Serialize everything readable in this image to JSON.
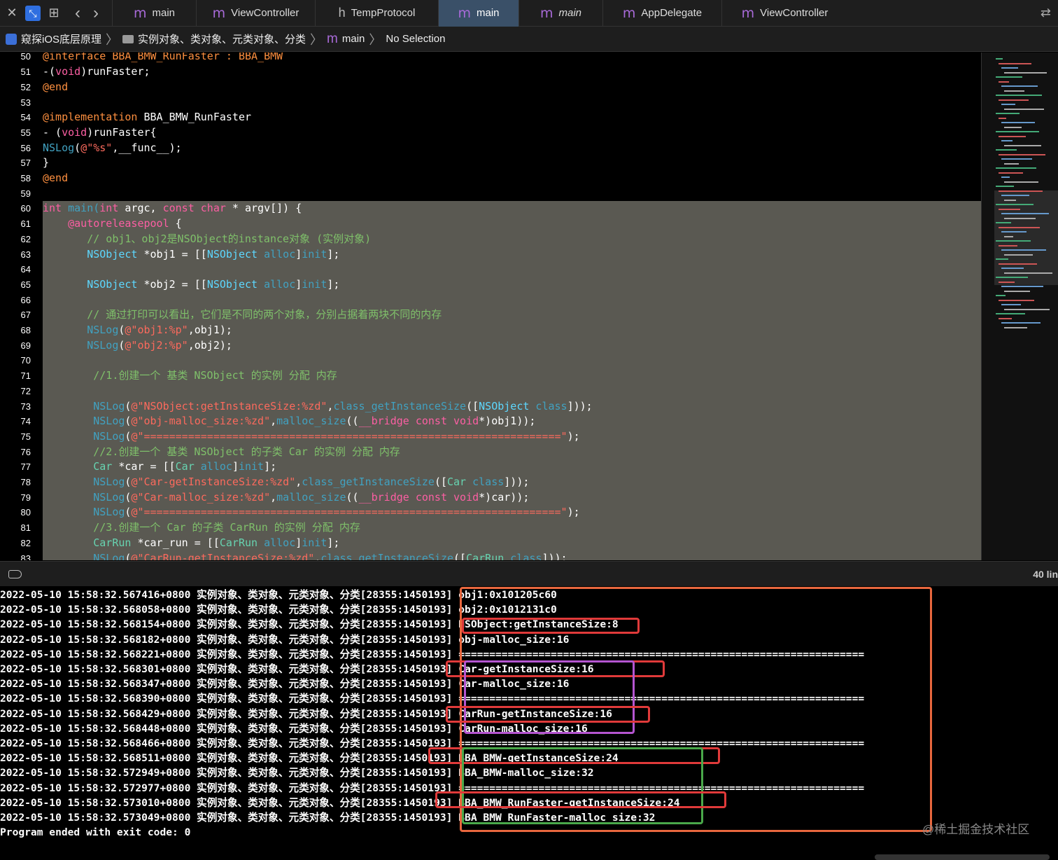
{
  "toolbar": {
    "close": "✕",
    "back": "‹",
    "forward": "›",
    "swap": "⇄"
  },
  "tabs": [
    {
      "label": "main",
      "icon": "m",
      "width": 120,
      "active": false,
      "italic": false
    },
    {
      "label": "ViewController",
      "icon": "m",
      "width": 170,
      "active": false,
      "italic": false
    },
    {
      "label": "TempProtocol",
      "icon": "h",
      "width": 176,
      "active": false,
      "italic": false
    },
    {
      "label": "main",
      "icon": "m",
      "width": 115,
      "active": true,
      "italic": false
    },
    {
      "label": "main",
      "icon": "m",
      "width": 120,
      "active": false,
      "italic": true
    },
    {
      "label": "AppDelegate",
      "icon": "m",
      "width": 170,
      "active": false,
      "italic": false
    },
    {
      "label": "ViewController",
      "icon": "m",
      "width": 180,
      "active": false,
      "italic": false
    }
  ],
  "breadcrumb": {
    "project": "窥探iOS底层原理",
    "folder": "实例对象、类对象、元类对象、分类",
    "file": "main",
    "selection": "No Selection",
    "file_icon": "m"
  },
  "editor": {
    "first_line_offset": -0.6,
    "highlight_from": 60,
    "lines": [
      {
        "n": 50,
        "t": [
          [
            "@interface BBA_BMW_RunFaster : BBA_BMW",
            "pp"
          ]
        ]
      },
      {
        "n": 51,
        "t": [
          [
            "-(",
            "pl"
          ],
          [
            "void",
            "kw"
          ],
          [
            ")runFaster;",
            "pl"
          ]
        ]
      },
      {
        "n": 52,
        "t": [
          [
            "@end",
            "pp"
          ]
        ]
      },
      {
        "n": 53,
        "t": []
      },
      {
        "n": 54,
        "t": [
          [
            "@implementation ",
            "pp"
          ],
          [
            "BBA_BMW_RunFaster",
            "pl"
          ]
        ]
      },
      {
        "n": 55,
        "t": [
          [
            "- (",
            "pl"
          ],
          [
            "void",
            "kw"
          ],
          [
            ")runFaster{",
            "pl"
          ]
        ]
      },
      {
        "n": 56,
        "t": [
          [
            "NSLog",
            "fn"
          ],
          [
            "(",
            "pl"
          ],
          [
            "@\"%s\"",
            "st"
          ],
          [
            ",__func__);",
            "pl"
          ]
        ]
      },
      {
        "n": 57,
        "t": [
          [
            "}",
            "pl"
          ]
        ]
      },
      {
        "n": 58,
        "t": [
          [
            "@end",
            "pp"
          ]
        ]
      },
      {
        "n": 59,
        "t": []
      },
      {
        "n": 60,
        "t": [
          [
            "int",
            "kw"
          ],
          [
            " main(",
            "fn"
          ],
          [
            "int",
            "kw"
          ],
          [
            " argc, ",
            "pl"
          ],
          [
            "const char",
            "kw"
          ],
          [
            " * argv[]) {",
            "pl"
          ]
        ]
      },
      {
        "n": 61,
        "t": [
          [
            "    ",
            "pl"
          ],
          [
            "@autoreleasepool",
            "kw"
          ],
          [
            " {",
            "pl"
          ]
        ]
      },
      {
        "n": 62,
        "t": [
          [
            "       // obj1、obj2是NSObject的instance对象 (实例对象)",
            "cm"
          ]
        ]
      },
      {
        "n": 63,
        "t": [
          [
            "       ",
            "pl"
          ],
          [
            "NSObject",
            "ty"
          ],
          [
            " *obj1 = [[",
            "pl"
          ],
          [
            "NSObject",
            "ty"
          ],
          [
            " alloc",
            "fn"
          ],
          [
            "]",
            "pl"
          ],
          [
            "init",
            "fn"
          ],
          [
            "];",
            "pl"
          ]
        ]
      },
      {
        "n": 64,
        "t": []
      },
      {
        "n": 65,
        "t": [
          [
            "       ",
            "pl"
          ],
          [
            "NSObject",
            "ty"
          ],
          [
            " *obj2 = [[",
            "pl"
          ],
          [
            "NSObject",
            "ty"
          ],
          [
            " alloc",
            "fn"
          ],
          [
            "]",
            "pl"
          ],
          [
            "init",
            "fn"
          ],
          [
            "];",
            "pl"
          ]
        ]
      },
      {
        "n": 66,
        "t": []
      },
      {
        "n": 67,
        "t": [
          [
            "       // 通过打印可以看出，它们是不同的两个对象，分别占据着两块不同的内存",
            "cm"
          ]
        ]
      },
      {
        "n": 68,
        "t": [
          [
            "       ",
            "pl"
          ],
          [
            "NSLog",
            "fn"
          ],
          [
            "(",
            "pl"
          ],
          [
            "@\"obj1:%p\"",
            "st"
          ],
          [
            ",obj1);",
            "pl"
          ]
        ]
      },
      {
        "n": 69,
        "t": [
          [
            "       ",
            "pl"
          ],
          [
            "NSLog",
            "fn"
          ],
          [
            "(",
            "pl"
          ],
          [
            "@\"obj2:%p\"",
            "st"
          ],
          [
            ",obj2);",
            "pl"
          ]
        ]
      },
      {
        "n": 70,
        "t": []
      },
      {
        "n": 71,
        "t": [
          [
            "        //1.创建一个 基类 NSObject 的实例 分配 内存",
            "cm"
          ]
        ]
      },
      {
        "n": 72,
        "t": []
      },
      {
        "n": 73,
        "t": [
          [
            "        ",
            "pl"
          ],
          [
            "NSLog",
            "fn"
          ],
          [
            "(",
            "pl"
          ],
          [
            "@\"NSObject:getInstanceSize:%zd\"",
            "st"
          ],
          [
            ",",
            "pl"
          ],
          [
            "class_getInstanceSize",
            "fn"
          ],
          [
            "([",
            "pl"
          ],
          [
            "NSObject",
            "ty"
          ],
          [
            " class",
            "fn"
          ],
          [
            "]));",
            "pl"
          ]
        ]
      },
      {
        "n": 74,
        "t": [
          [
            "        ",
            "pl"
          ],
          [
            "NSLog",
            "fn"
          ],
          [
            "(",
            "pl"
          ],
          [
            "@\"obj-malloc_size:%zd\"",
            "st"
          ],
          [
            ",",
            "pl"
          ],
          [
            "malloc_size",
            "fn"
          ],
          [
            "((",
            "pl"
          ],
          [
            "__bridge const void",
            "kw"
          ],
          [
            "*)obj1));",
            "pl"
          ]
        ]
      },
      {
        "n": 75,
        "t": [
          [
            "        ",
            "pl"
          ],
          [
            "NSLog",
            "fn"
          ],
          [
            "(",
            "pl"
          ],
          [
            "@\"==================================================================\"",
            "st"
          ],
          [
            ");",
            "pl"
          ]
        ]
      },
      {
        "n": 76,
        "t": [
          [
            "        //2.创建一个 基类 NSObject 的子类 Car 的实例 分配 内存",
            "cm"
          ]
        ]
      },
      {
        "n": 77,
        "t": [
          [
            "        ",
            "pl"
          ],
          [
            "Car",
            "cg"
          ],
          [
            " *car = [[",
            "pl"
          ],
          [
            "Car",
            "cg"
          ],
          [
            " alloc",
            "fn"
          ],
          [
            "]",
            "pl"
          ],
          [
            "init",
            "fn"
          ],
          [
            "];",
            "pl"
          ]
        ]
      },
      {
        "n": 78,
        "t": [
          [
            "        ",
            "pl"
          ],
          [
            "NSLog",
            "fn"
          ],
          [
            "(",
            "pl"
          ],
          [
            "@\"Car-getInstanceSize:%zd\"",
            "st"
          ],
          [
            ",",
            "pl"
          ],
          [
            "class_getInstanceSize",
            "fn"
          ],
          [
            "([",
            "pl"
          ],
          [
            "Car",
            "cg"
          ],
          [
            " class",
            "fn"
          ],
          [
            "]));",
            "pl"
          ]
        ]
      },
      {
        "n": 79,
        "t": [
          [
            "        ",
            "pl"
          ],
          [
            "NSLog",
            "fn"
          ],
          [
            "(",
            "pl"
          ],
          [
            "@\"Car-malloc_size:%zd\"",
            "st"
          ],
          [
            ",",
            "pl"
          ],
          [
            "malloc_size",
            "fn"
          ],
          [
            "((",
            "pl"
          ],
          [
            "__bridge const void",
            "kw"
          ],
          [
            "*)car));",
            "pl"
          ]
        ]
      },
      {
        "n": 80,
        "t": [
          [
            "        ",
            "pl"
          ],
          [
            "NSLog",
            "fn"
          ],
          [
            "(",
            "pl"
          ],
          [
            "@\"==================================================================\"",
            "st"
          ],
          [
            ");",
            "pl"
          ]
        ]
      },
      {
        "n": 81,
        "t": [
          [
            "        //3.创建一个 Car 的子类 CarRun 的实例 分配 内存",
            "cm"
          ]
        ]
      },
      {
        "n": 82,
        "t": [
          [
            "        ",
            "pl"
          ],
          [
            "CarRun",
            "cg"
          ],
          [
            " *car_run = [[",
            "pl"
          ],
          [
            "CarRun",
            "cg"
          ],
          [
            " alloc",
            "fn"
          ],
          [
            "]",
            "pl"
          ],
          [
            "init",
            "fn"
          ],
          [
            "];",
            "pl"
          ]
        ]
      },
      {
        "n": 83,
        "t": [
          [
            "        ",
            "pl"
          ],
          [
            "NSLog",
            "fn"
          ],
          [
            "(",
            "pl"
          ],
          [
            "@\"CarRun-getInstanceSize:%zd\"",
            "st"
          ],
          [
            ",",
            "pl"
          ],
          [
            "class_getInstanceSize",
            "fn"
          ],
          [
            "([",
            "pl"
          ],
          [
            "CarRun",
            "cg"
          ],
          [
            " class",
            "fn"
          ],
          [
            "]));",
            "pl"
          ]
        ]
      }
    ]
  },
  "console": {
    "line_count": "40 lin",
    "prefix": "实例对象、类对象、元类对象、分类[28355:1450193]",
    "rows": [
      {
        "ts": "2022-05-10 15:58:32.567416+0800",
        "msg": "obj1:0x101205c60"
      },
      {
        "ts": "2022-05-10 15:58:32.568058+0800",
        "msg": "obj2:0x1012131c0"
      },
      {
        "ts": "2022-05-10 15:58:32.568154+0800",
        "msg": "NSObject:getInstanceSize:8"
      },
      {
        "ts": "2022-05-10 15:58:32.568182+0800",
        "msg": "obj-malloc_size:16"
      },
      {
        "ts": "2022-05-10 15:58:32.568221+0800",
        "msg": "=================================================================="
      },
      {
        "ts": "2022-05-10 15:58:32.568301+0800",
        "msg": "Car-getInstanceSize:16"
      },
      {
        "ts": "2022-05-10 15:58:32.568347+0800",
        "msg": "Car-malloc_size:16"
      },
      {
        "ts": "2022-05-10 15:58:32.568390+0800",
        "msg": "=================================================================="
      },
      {
        "ts": "2022-05-10 15:58:32.568429+0800",
        "msg": "CarRun-getInstanceSize:16"
      },
      {
        "ts": "2022-05-10 15:58:32.568448+0800",
        "msg": "CarRun-malloc_size:16"
      },
      {
        "ts": "2022-05-10 15:58:32.568466+0800",
        "msg": "=================================================================="
      },
      {
        "ts": "2022-05-10 15:58:32.568511+0800",
        "msg": "BBA_BMW-getInstanceSize:24"
      },
      {
        "ts": "2022-05-10 15:58:32.572949+0800",
        "msg": "BBA_BMW-malloc_size:32"
      },
      {
        "ts": "2022-05-10 15:58:32.572977+0800",
        "msg": "=================================================================="
      },
      {
        "ts": "2022-05-10 15:58:32.573010+0800",
        "msg": "BBA_BMW_RunFaster-getInstanceSize:24"
      },
      {
        "ts": "2022-05-10 15:58:32.573049+0800",
        "msg": "BBA_BMW_RunFaster-malloc_size:32"
      }
    ],
    "exit": "Program ended with exit code: 0"
  },
  "annotation_colors": {
    "orange": "#e8673e",
    "red": "#e03a3a",
    "purple": "#b455d0",
    "green": "#4aa84a"
  },
  "watermark": "@稀土掘金技术社区"
}
